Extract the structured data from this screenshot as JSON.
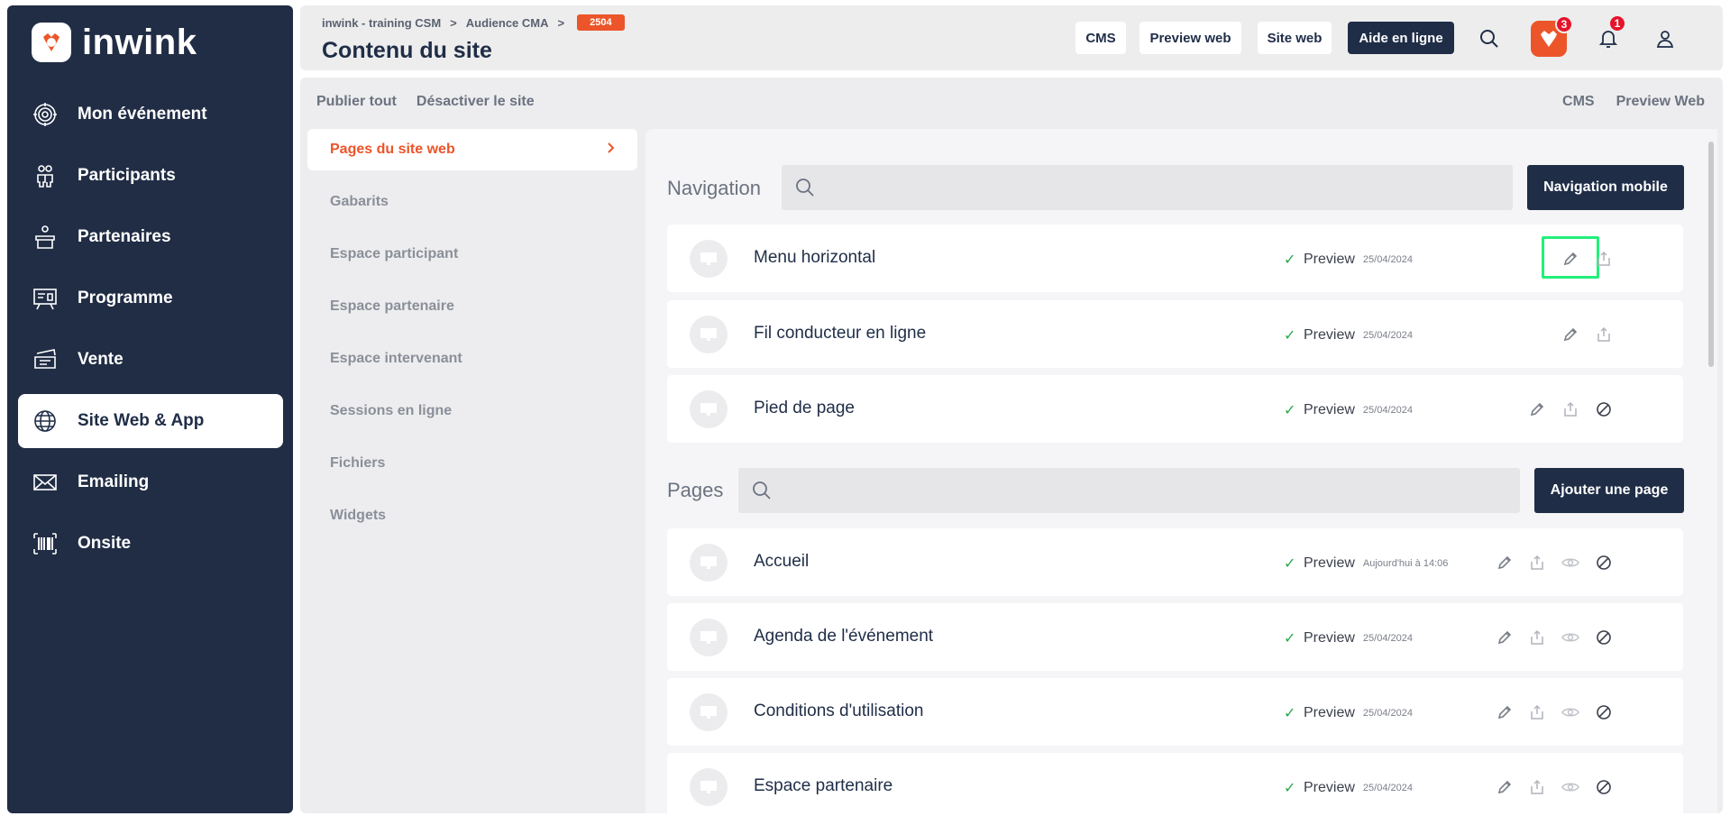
{
  "brand": {
    "name": "inwink",
    "accent": "#ec5529",
    "dark": "#212d45"
  },
  "sidebar": {
    "items": [
      {
        "label": "Mon événement",
        "icon": "target-icon"
      },
      {
        "label": "Participants",
        "icon": "participants-icon"
      },
      {
        "label": "Partenaires",
        "icon": "podium-icon"
      },
      {
        "label": "Programme",
        "icon": "presentation-icon"
      },
      {
        "label": "Vente",
        "icon": "tickets-icon"
      },
      {
        "label": "Site Web & App",
        "icon": "globe-icon",
        "active": true
      },
      {
        "label": "Emailing",
        "icon": "envelope-icon"
      },
      {
        "label": "Onsite",
        "icon": "barcode-icon"
      }
    ]
  },
  "header": {
    "breadcrumb": [
      "inwink - training CSM",
      "Audience CMA"
    ],
    "breadcrumb_separator": ">",
    "event_id": "2504",
    "title": "Contenu du site",
    "buttons": {
      "cms": "CMS",
      "preview_web": "Preview web",
      "site_web": "Site web",
      "aide": "Aide en ligne"
    },
    "gift_count": "3",
    "notification_count": "1"
  },
  "toolbar": {
    "left": [
      "Publier tout",
      "Désactiver le site"
    ],
    "right": [
      "CMS",
      "Preview Web"
    ]
  },
  "subnav": {
    "items": [
      {
        "label": "Pages du site web",
        "active": true
      },
      {
        "label": "Gabarits"
      },
      {
        "label": "Espace participant"
      },
      {
        "label": "Espace partenaire"
      },
      {
        "label": "Espace intervenant"
      },
      {
        "label": "Sessions en ligne"
      },
      {
        "label": "Fichiers"
      },
      {
        "label": "Widgets"
      }
    ]
  },
  "navigation": {
    "label": "Navigation",
    "button": "Navigation mobile",
    "rows": [
      {
        "title": "Menu horizontal",
        "status": "Preview",
        "date": "25/04/2024"
      },
      {
        "title": "Fil conducteur en ligne",
        "status": "Preview",
        "date": "25/04/2024"
      },
      {
        "title": "Pied de page",
        "status": "Preview",
        "date": "25/04/2024"
      }
    ]
  },
  "pages": {
    "label": "Pages",
    "button": "Ajouter une page",
    "rows": [
      {
        "title": "Accueil",
        "status": "Preview",
        "date": "Aujourd'hui à 14:06"
      },
      {
        "title": "Agenda de l'événement",
        "status": "Preview",
        "date": "25/04/2024"
      },
      {
        "title": "Conditions d'utilisation",
        "status": "Preview",
        "date": "25/04/2024"
      },
      {
        "title": "Espace partenaire",
        "status": "Preview",
        "date": "25/04/2024"
      }
    ]
  }
}
